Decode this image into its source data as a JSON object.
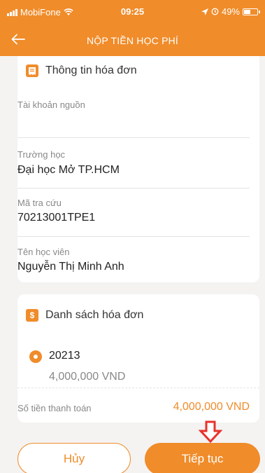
{
  "status_bar": {
    "carrier": "MobiFone",
    "time": "09:25",
    "battery": "49%"
  },
  "header": {
    "title": "NỘP TIỀN HỌC PHÍ"
  },
  "invoice_info": {
    "title": "Thông tin hóa đơn",
    "source_account_label": "Tài khoản nguồn",
    "source_account_value": "",
    "school_label": "Trường học",
    "school_value": "Đại học Mở TP.HCM",
    "lookup_code_label": "Mã tra cứu",
    "lookup_code_value": "70213001TPE1",
    "student_name_label": "Tên học viên",
    "student_name_value": "Nguyễn Thị Minh Anh"
  },
  "invoice_list": {
    "title": "Danh sách hóa đơn",
    "items": [
      {
        "code": "20213",
        "amount": "4,000,000 VND",
        "selected": true
      }
    ],
    "total_label": "Số tiền thanh toán",
    "total_value": "4,000,000 VND"
  },
  "actions": {
    "cancel_label": "Hủy",
    "continue_label": "Tiếp tục"
  },
  "colors": {
    "brand": "#f08c2a",
    "annotation_arrow": "#e8322b"
  },
  "icons": {
    "back": "arrow-left-icon",
    "invoice": "receipt-icon",
    "money": "dollar-icon",
    "annotation": "arrow-down-icon"
  }
}
